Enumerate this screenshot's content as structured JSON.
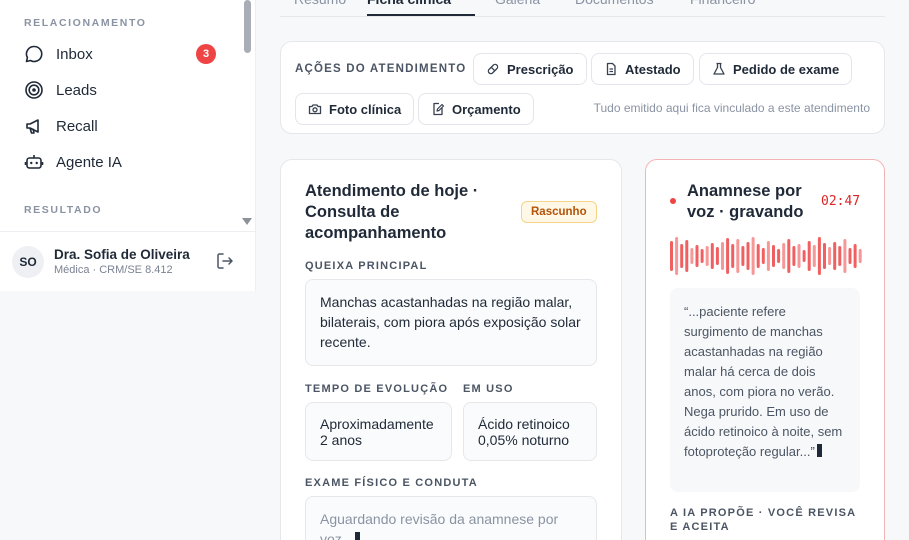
{
  "sidebar": {
    "section_relacionamento": "RELACIONAMENTO",
    "section_resultado": "RESULTADO",
    "items": [
      {
        "label": "Inbox",
        "badge": "3",
        "icon": "chat-bubble-icon"
      },
      {
        "label": "Leads",
        "icon": "target-icon"
      },
      {
        "label": "Recall",
        "icon": "megaphone-icon"
      },
      {
        "label": "Agente IA",
        "icon": "robot-icon"
      }
    ],
    "user": {
      "initials": "SO",
      "name": "Dra. Sofia de Oliveira",
      "role": "Médica · CRM/SE 8.412"
    }
  },
  "tabs": [
    {
      "label": "Resumo",
      "active": false
    },
    {
      "label": "Ficha clínica",
      "active": true
    },
    {
      "label": "Galeria",
      "active": false
    },
    {
      "label": "Documentos",
      "active": false
    },
    {
      "label": "Financeiro",
      "active": false
    }
  ],
  "actions": {
    "title": "AÇÕES DO ATENDIMENTO",
    "buttons": [
      {
        "label": "Prescrição",
        "icon": "pill-icon"
      },
      {
        "label": "Atestado",
        "icon": "document-icon"
      },
      {
        "label": "Pedido de exame",
        "icon": "flask-icon"
      },
      {
        "label": "Foto clínica",
        "icon": "camera-icon"
      },
      {
        "label": "Orçamento",
        "icon": "edit-document-icon"
      }
    ],
    "note": "Tudo emitido aqui fica vinculado a este atendimento"
  },
  "consultation": {
    "title": "Atendimento de hoje · Consulta de acompanhamento",
    "status": "Rascunho",
    "complaint_label": "QUEIXA PRINCIPAL",
    "complaint_value": "Manchas acastanhadas na região malar, bilaterais, com piora após exposição solar recente.",
    "evolution_label": "TEMPO DE EVOLUÇÃO",
    "evolution_value": "Aproximadamente 2 anos",
    "in_use_label": "EM USO",
    "in_use_value": "Ácido retinoico 0,05% noturno",
    "exam_label": "EXAME FÍSICO E CONDUTA",
    "exam_placeholder": "Aguardando revisão da anamnese por voz..."
  },
  "voice": {
    "title": "Anamnese por voz · gravando",
    "timer": "02:47",
    "transcript": "“...paciente refere surgimento de manchas acastanhadas na região malar há cerca de dois anos, com piora no verão. Nega prurido. Em uso de ácido retinoico à noite, sem fotoproteção regular...”",
    "ai_label": "A IA PROPÕE · VOCÊ REVISA E ACEITA",
    "waveform_levels": [
      0.75,
      0.95,
      0.6,
      0.8,
      0.4,
      0.55,
      0.35,
      0.5,
      0.65,
      0.45,
      0.7,
      0.9,
      0.6,
      0.85,
      0.5,
      0.7,
      0.95,
      0.6,
      0.4,
      0.75,
      0.55,
      0.35,
      0.65,
      0.85,
      0.5,
      0.6,
      0.3,
      0.75,
      0.55,
      0.95,
      0.65,
      0.45,
      0.7,
      0.5,
      0.85,
      0.4,
      0.6,
      0.35
    ],
    "accent_color": "#ef4444"
  }
}
